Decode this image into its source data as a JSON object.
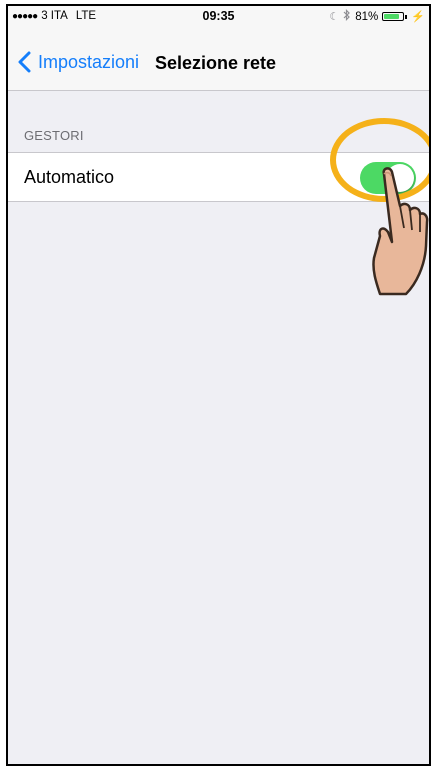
{
  "status_bar": {
    "signal_dots": "●●●●●",
    "carrier": "3 ITA",
    "network": "LTE",
    "time": "09:35",
    "moon_icon": "moon-icon",
    "bluetooth_icon": "bluetooth-icon",
    "battery_percent": "81%",
    "battery_level": 0.81,
    "charging_icon": "bolt-icon"
  },
  "nav": {
    "back_label": "Impostazioni",
    "title": "Selezione rete"
  },
  "section": {
    "header": "GESTORI",
    "row_label": "Automatico",
    "toggle_on": true
  },
  "colors": {
    "ios_blue": "#147efb",
    "toggle_green": "#4cd964",
    "highlight_orange": "#f5b119",
    "grouped_background": "#efeff4"
  }
}
